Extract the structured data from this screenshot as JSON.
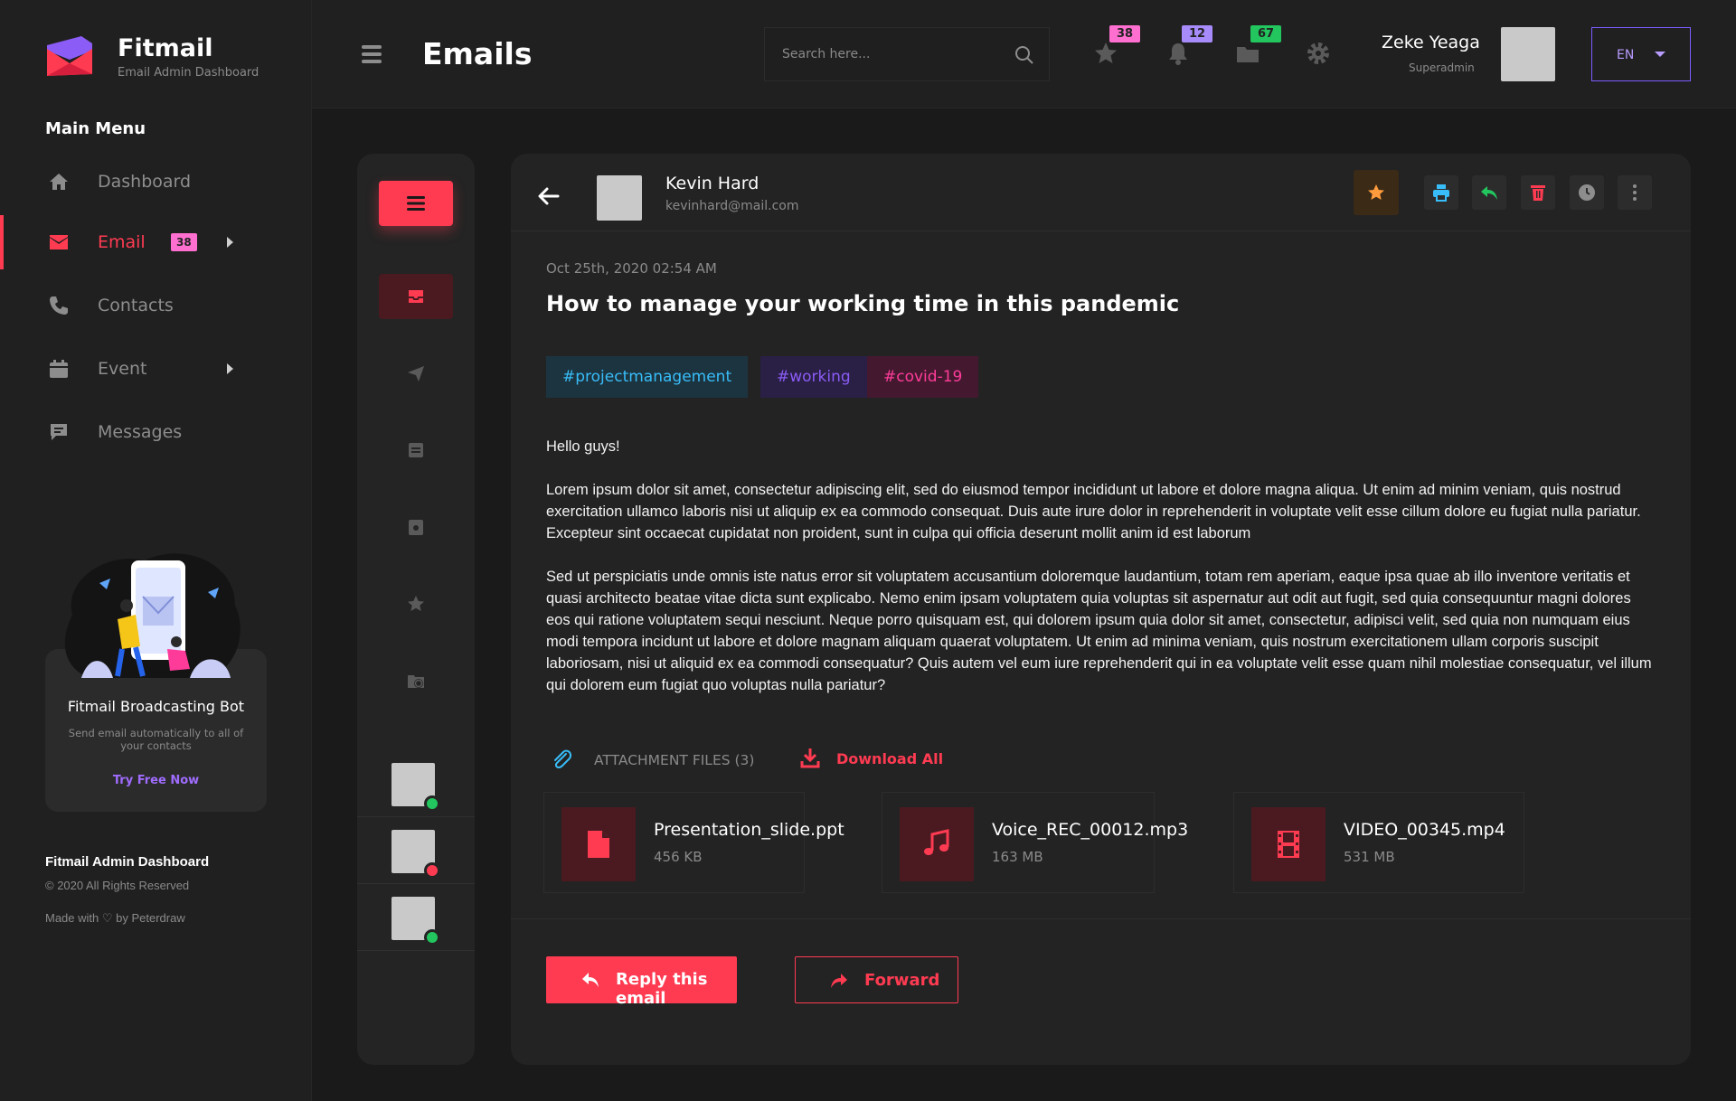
{
  "brand": {
    "title": "Fitmail",
    "subtitle": "Email Admin Dashboard"
  },
  "sidebar": {
    "heading": "Main Menu",
    "items": [
      {
        "label": "Dashboard",
        "icon": "home-icon"
      },
      {
        "label": "Email",
        "icon": "mail-icon",
        "badge": "38",
        "active": true
      },
      {
        "label": "Contacts",
        "icon": "phone-icon"
      },
      {
        "label": "Event",
        "icon": "calendar-icon"
      },
      {
        "label": "Messages",
        "icon": "chat-icon"
      }
    ],
    "promo": {
      "title": "Fitmail Broadcasting Bot",
      "description": "Send email automatically to all of your contacts",
      "link": "Try Free Now"
    },
    "footer": {
      "title": "Fitmail Admin Dashboard",
      "copyright": "© 2020 All Rights Reserved",
      "made_with": "Made with ♡ by Peterdraw"
    }
  },
  "header": {
    "title": "Emails",
    "search_placeholder": "Search here...",
    "badges": {
      "favorites": "38",
      "notifications": "12",
      "folders": "67"
    },
    "user": {
      "name": "Zeke Yeaga",
      "role": "Superadmin"
    },
    "language": "EN"
  },
  "email": {
    "sender_name": "Kevin Hard",
    "sender_email": "kevinhard@mail.com",
    "date": "Oct 25th, 2020  02:54 AM",
    "subject": "How to manage your working time in this pandemic",
    "tags": [
      "#projectmanagement",
      "#working",
      "#covid-19"
    ],
    "greeting": "Hello guys!",
    "paragraph1": "Lorem ipsum dolor sit amet, consectetur adipiscing elit, sed do eiusmod tempor incididunt ut labore et dolore magna aliqua. Ut enim ad minim veniam, quis nostrud exercitation ullamco laboris nisi ut aliquip ex ea commodo consequat. Duis aute irure dolor in reprehenderit in voluptate velit esse cillum dolore eu fugiat nulla pariatur. Excepteur sint occaecat cupidatat non proident, sunt in culpa qui officia deserunt mollit anim id est laborum",
    "paragraph2": "Sed ut perspiciatis unde omnis iste natus error sit voluptatem accusantium doloremque laudantium, totam rem aperiam, eaque ipsa quae ab illo inventore veritatis et quasi architecto beatae vitae dicta sunt explicabo. Nemo enim ipsam voluptatem quia voluptas sit aspernatur aut odit aut fugit, sed quia consequuntur magni dolores eos qui ratione voluptatem sequi nesciunt. Neque porro quisquam est, qui dolorem ipsum quia dolor sit amet, consectetur, adipisci velit, sed quia non numquam eius modi tempora incidunt ut labore et dolore magnam aliquam quaerat voluptatem. Ut enim ad minima veniam, quis nostrum exercitationem ullam corporis suscipit laboriosam, nisi ut aliquid ex ea commodi consequatur? Quis autem vel eum iure reprehenderit qui in ea voluptate velit esse quam nihil molestiae consequatur, vel illum qui dolorem eum fugiat quo voluptas nulla pariatur?",
    "attachments_label": "ATTACHMENT FILES (3)",
    "download_all": "Download All",
    "files": [
      {
        "name": "Presentation_slide.ppt",
        "size": "456 KB",
        "icon": "file-icon"
      },
      {
        "name": "Voice_REC_00012.mp3",
        "size": "163 MB",
        "icon": "music-icon"
      },
      {
        "name": "VIDEO_00345.mp4",
        "size": "531 MB",
        "icon": "film-icon"
      }
    ],
    "reply_label": "Reply this email",
    "forward_label": "Forward"
  },
  "colors": {
    "accent": "#ff3b52",
    "purple": "#a06cff",
    "background": "#1a1a1a",
    "panel": "#232323"
  }
}
